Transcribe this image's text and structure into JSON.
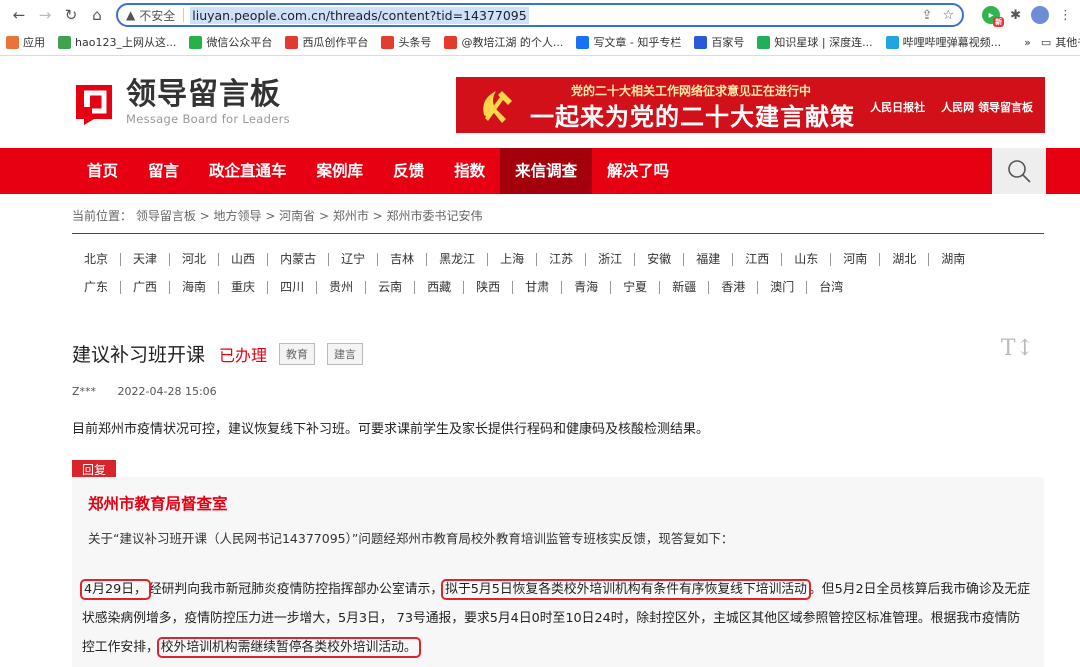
{
  "browser": {
    "security_label": "不安全",
    "url_host": "liuyan.people.com.cn",
    "url_path": "/threads/content?tid=14377095",
    "ext_badge": "新",
    "bookmarks": [
      {
        "label": "应用",
        "color": "#e8743a"
      },
      {
        "label": "hao123_上网从这...",
        "color": "#3fa34d"
      },
      {
        "label": "微信公众平台",
        "color": "#27b14b"
      },
      {
        "label": "西瓜创作平台",
        "color": "#e03b31"
      },
      {
        "label": "头条号",
        "color": "#e23d2e"
      },
      {
        "label": "@教培江湖 的个人...",
        "color": "#e33a2b"
      },
      {
        "label": "写文章 - 知乎专栏",
        "color": "#1772f6"
      },
      {
        "label": "百家号",
        "color": "#2a5ad8"
      },
      {
        "label": "知识星球 | 深度连...",
        "color": "#21b05a"
      },
      {
        "label": "哔哩哔哩弹幕视频...",
        "color": "#21a5e2"
      }
    ],
    "bookmarks_more": "»",
    "other_bookmarks": "其他书签"
  },
  "site": {
    "logo_cn": "领导留言板",
    "logo_en": "Message Board for Leaders",
    "banner_top": "党的二十大相关工作网络征求意见正在进行中",
    "banner_main": "一起来为党的二十大建言献策",
    "banner_logo1": "人民日报社",
    "banner_logo2": "人民网 领导留言板",
    "colors": {
      "brand_red": "#e60012",
      "active_nav": "#a3000c"
    }
  },
  "nav": {
    "items": [
      "首页",
      "留言",
      "政企直通车",
      "案例库",
      "反馈",
      "指数",
      "来信调查",
      "解决了吗"
    ],
    "active_index": 6
  },
  "breadcrumb": "当前位置： 领导留言板 > 地方领导 > 河南省 > 郑州市 > 郑州市委书记安伟",
  "provinces_row1": [
    "北京",
    "天津",
    "河北",
    "山西",
    "内蒙古",
    "辽宁",
    "吉林",
    "黑龙江",
    "上海",
    "江苏",
    "浙江",
    "安徽",
    "福建",
    "江西",
    "山东",
    "河南",
    "湖北",
    "湖南"
  ],
  "provinces_row2": [
    "广东",
    "广西",
    "海南",
    "重庆",
    "四川",
    "贵州",
    "云南",
    "西藏",
    "陕西",
    "甘肃",
    "青海",
    "宁夏",
    "新疆",
    "香港",
    "澳门",
    "台湾"
  ],
  "thread": {
    "title": "建议补习班开课",
    "status": "已办理",
    "tags": [
      "教育",
      "建言"
    ],
    "text_size_icon": "T",
    "author": "Z***",
    "time": "2022-04-28 15:06",
    "question": "目前郑州市疫情状况可控，建议恢复线下补习班。可要求课前学生及家长提供行程码和健康码及核酸检测结果。"
  },
  "reply": {
    "badge": "回复",
    "office": "郑州市教育局督查室",
    "intro": "关于“建议补习班开课（人民网书记14377095）”问题经郑州市教育局校外教育培训监管专班核实反馈，现答复如下：",
    "p_date": "4月29日，",
    "p_a": "经研判向我市新冠肺炎疫情防控指挥部办公室请示，",
    "p_hl1": "拟于5月5日恢复各类校外培训机构有条件有序恢复线下培训活动",
    "p_b": "。但5月2日全员核算后我市确诊及无症状感染病例增多，疫情防控压力进一步增大，5月3日， 73号通报，要求5月4日0时至10日24时，除封控区外，主城区其他区域参照管控区标准管理。根据我市疫情防控工作安排，",
    "p_hl2": "校外培训机构需继续暂停各类校外培训活动。"
  }
}
